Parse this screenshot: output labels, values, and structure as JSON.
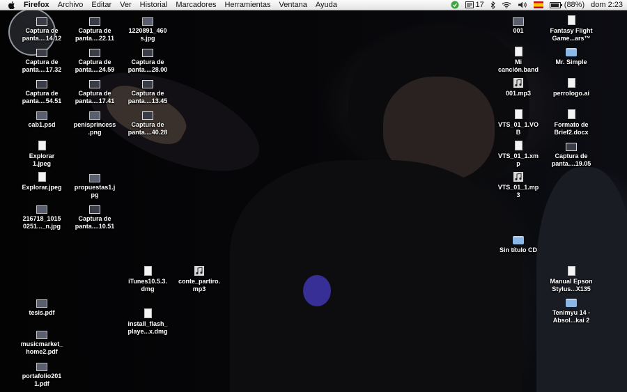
{
  "menubar": {
    "items": [
      "Firefox",
      "Archivo",
      "Editar",
      "Ver",
      "Historial",
      "Marcadores",
      "Herramientas",
      "Ventana",
      "Ayuda"
    ],
    "status": {
      "adium_count": "17",
      "battery": "(88%)",
      "clock": "dom 2:23"
    }
  },
  "icons": [
    {
      "label": "Captura de\npanta....14.12",
      "icon": "screenshot-icon"
    },
    {
      "label": "Captura de\npanta....22.11",
      "icon": "screenshot-icon"
    },
    {
      "label": "1220891_460\ns.jpg",
      "icon": "image-icon"
    },
    {
      "label": "Captura de\npanta....17.32",
      "icon": "screenshot-icon"
    },
    {
      "label": "Captura de\npanta....24.59",
      "icon": "screenshot-icon"
    },
    {
      "label": "Captura de\npanta....28.00",
      "icon": "screenshot-icon"
    },
    {
      "label": "Captura de\npanta....54.51",
      "icon": "screenshot-icon"
    },
    {
      "label": "Captura de\npanta....17.41",
      "icon": "screenshot-icon"
    },
    {
      "label": "Captura de\npanta....13.45",
      "icon": "screenshot-icon"
    },
    {
      "label": "cab1.psd",
      "icon": "image-icon"
    },
    {
      "label": "penisprincess\n.png",
      "icon": "image-icon"
    },
    {
      "label": "Captura de\npanta....40.28",
      "icon": "screenshot-icon"
    },
    {
      "label": "Explorar\n1.jpeg",
      "icon": "document-icon"
    },
    {
      "label": "Explorar.jpeg",
      "icon": "document-icon"
    },
    {
      "label": "propuestas1.j\npg",
      "icon": "image-icon"
    },
    {
      "label": "216718_1015\n0251..._n.jpg",
      "icon": "image-icon"
    },
    {
      "label": "Captura de\npanta....10.51",
      "icon": "screenshot-icon"
    },
    {
      "label": "iTunes10.5.3.\ndmg",
      "icon": "document-icon"
    },
    {
      "label": "conte_partiro.\nmp3",
      "icon": "music-icon"
    },
    {
      "label": "tesis.pdf",
      "icon": "image-icon"
    },
    {
      "label": "install_flash_\nplaye...x.dmg",
      "icon": "document-icon"
    },
    {
      "label": "musicmarket_\nhome2.pdf",
      "icon": "image-icon"
    },
    {
      "label": "portafolio201\n1.pdf",
      "icon": "image-icon"
    },
    {
      "label": "001",
      "icon": "image-icon"
    },
    {
      "label": "Fantasy Flight\nGame...ars™",
      "icon": "document-icon"
    },
    {
      "label": "Mi\ncanción.band",
      "icon": "document-icon"
    },
    {
      "label": "Mr. Simple",
      "icon": "folder-icon"
    },
    {
      "label": "001.mp3",
      "icon": "music-icon"
    },
    {
      "label": "perrologo.ai",
      "icon": "document-icon"
    },
    {
      "label": "VTS_01_1.VO\nB",
      "icon": "document-icon"
    },
    {
      "label": "Formato de\nBrief2.docx",
      "icon": "document-icon"
    },
    {
      "label": "VTS_01_1.xm\np",
      "icon": "document-icon"
    },
    {
      "label": "Captura de\npanta....19.05",
      "icon": "screenshot-icon"
    },
    {
      "label": "VTS_01_1.mp\n3",
      "icon": "music-icon"
    },
    {
      "label": "Sin título CD",
      "icon": "folder-icon"
    },
    {
      "label": "Manual Epson\nStylus...X135",
      "icon": "document-icon"
    },
    {
      "label": "Tenimyu 14 -\nAbsol...kai 2",
      "icon": "folder-icon"
    }
  ]
}
